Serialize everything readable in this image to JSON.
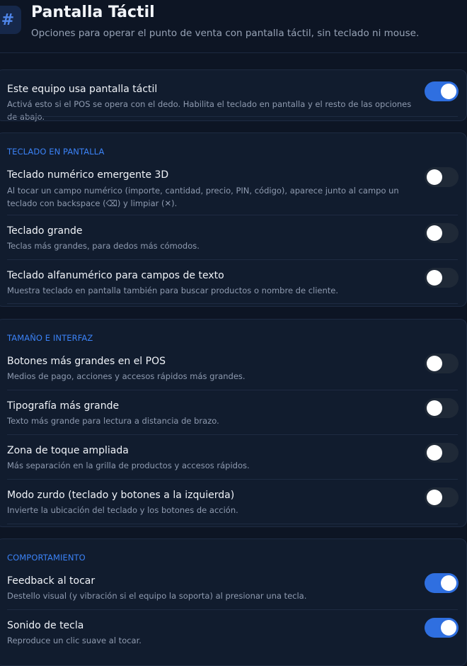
{
  "header": {
    "icon": "hash-icon",
    "title": "Pantalla Táctil",
    "subtitle": "Opciones para operar el punto de venta con pantalla táctil, sin teclado ni mouse."
  },
  "main_setting": {
    "title": "Este equipo usa pantalla táctil",
    "desc": "Activá esto si el POS se opera con el dedo. Habilita el teclado en pantalla y el resto de las opciones de abajo.",
    "on": true
  },
  "sections": [
    {
      "label": "TECLADO EN PANTALLA",
      "items": [
        {
          "title": "Teclado numérico emergente 3D",
          "desc": "Al tocar un campo numérico (importe, cantidad, precio, PIN, código), aparece junto al campo un teclado con backspace (⌫) y limpiar (✕).",
          "on": false
        },
        {
          "title": "Teclado grande",
          "desc": "Teclas más grandes, para dedos más cómodos.",
          "on": false
        },
        {
          "title": "Teclado alfanumérico para campos de texto",
          "desc": "Muestra teclado en pantalla también para buscar productos o nombre de cliente.",
          "on": false
        }
      ]
    },
    {
      "label": "TAMAÑO E INTERFAZ",
      "items": [
        {
          "title": "Botones más grandes en el POS",
          "desc": "Medios de pago, acciones y accesos rápidos más grandes.",
          "on": false
        },
        {
          "title": "Tipografía más grande",
          "desc": "Texto más grande para lectura a distancia de brazo.",
          "on": false
        },
        {
          "title": "Zona de toque ampliada",
          "desc": "Más separación en la grilla de productos y accesos rápidos.",
          "on": false
        },
        {
          "title": "Modo zurdo (teclado y botones a la izquierda)",
          "desc": "Invierte la ubicación del teclado y los botones de acción.",
          "on": false
        }
      ]
    },
    {
      "label": "COMPORTAMIENTO",
      "items": [
        {
          "title": "Feedback al tocar",
          "desc": "Destello visual (y vibración si el equipo la soporta) al presionar una tecla.",
          "on": true
        },
        {
          "title": "Sonido de tecla",
          "desc": "Reproduce un clic suave al tocar.",
          "on": true
        }
      ]
    }
  ],
  "colors": {
    "background": "#0d1524",
    "card": "#111c2e",
    "accent": "#3b82f6",
    "toggle_on": "#2f6fe0",
    "toggle_off": "#1f2937"
  }
}
